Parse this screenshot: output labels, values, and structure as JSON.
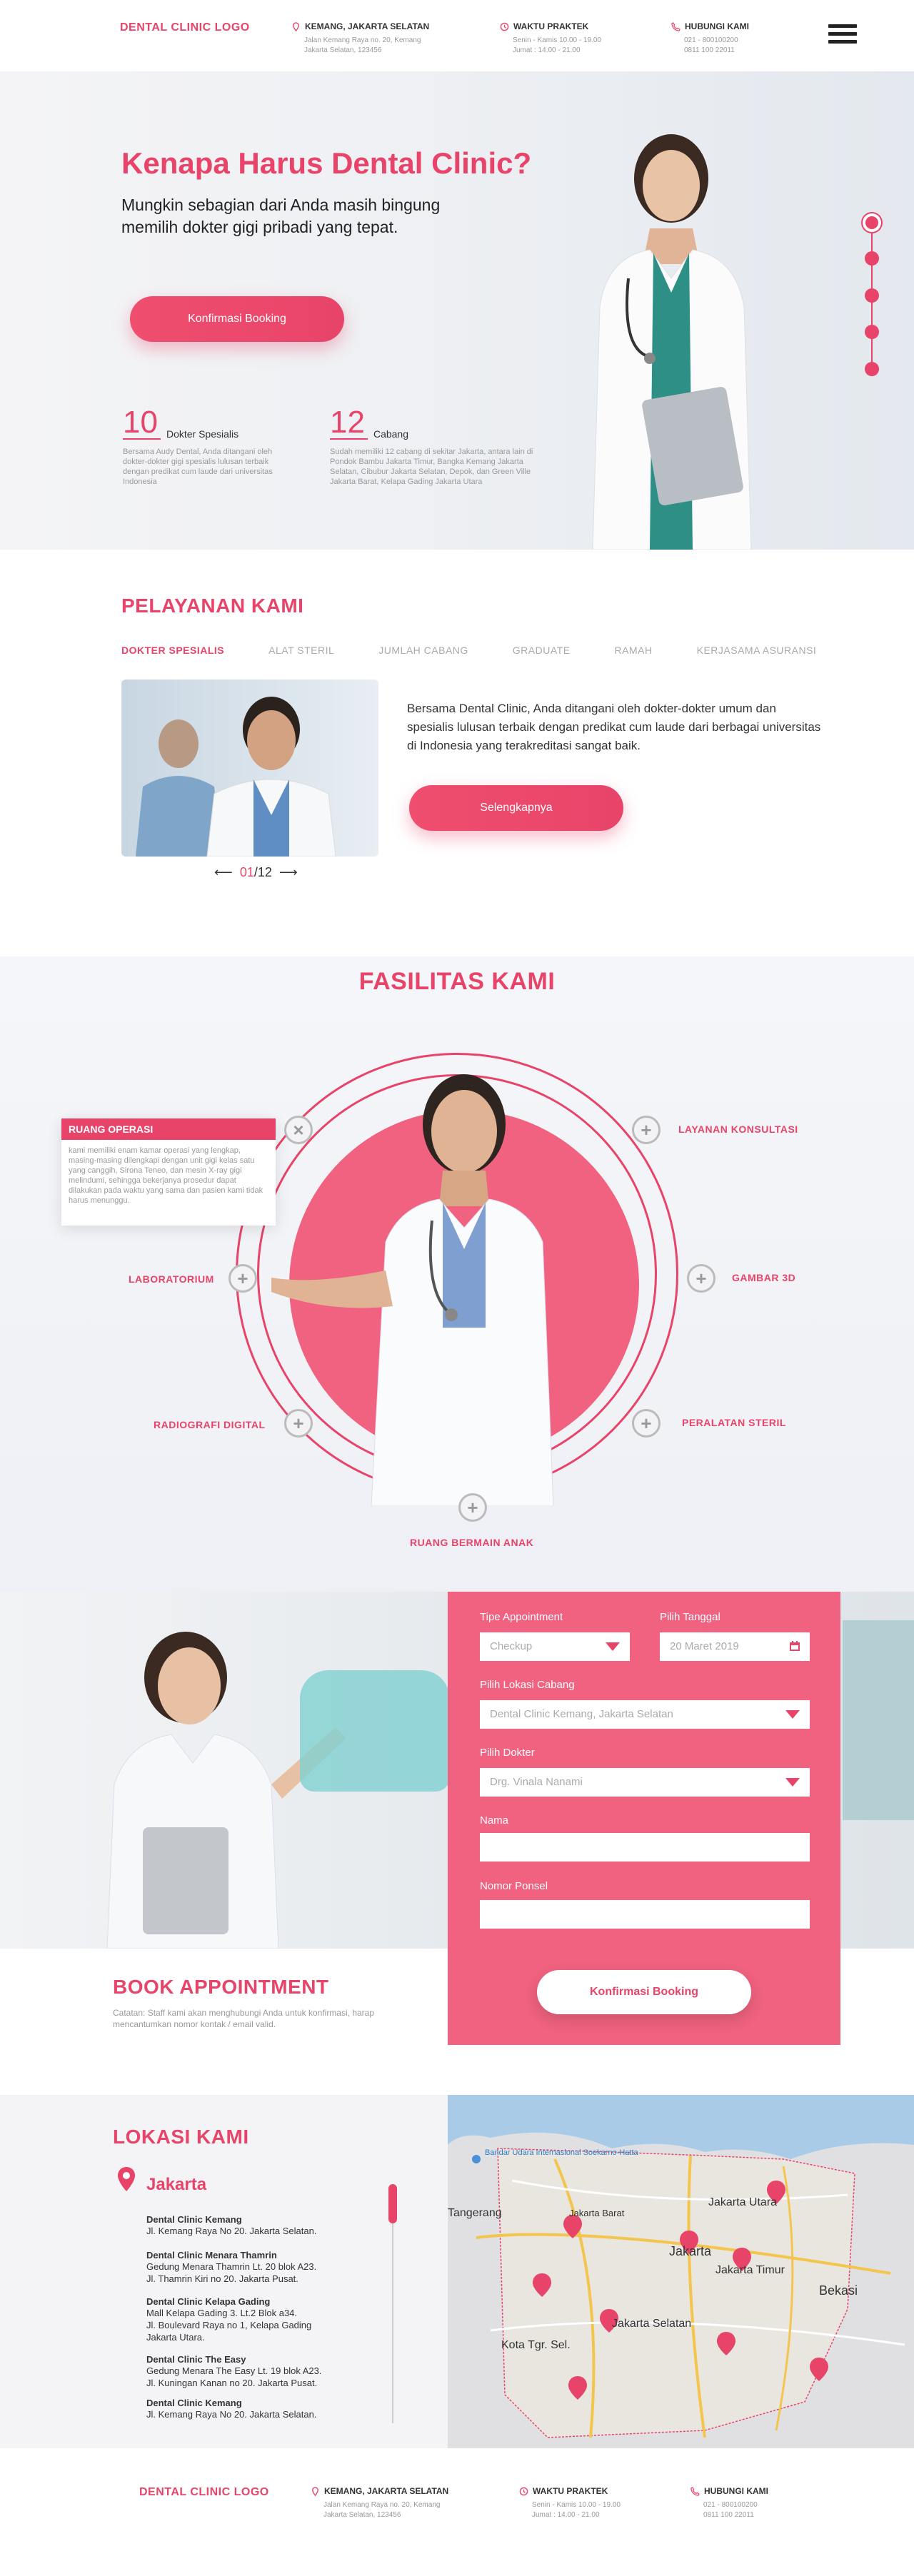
{
  "header": {
    "logo": "DENTAL CLINIC  LOGO",
    "location": {
      "title": "KEMANG, JAKARTA SELATAN",
      "line1": "Jalan Kemang Raya no. 20, Kemang",
      "line2": "Jakarta Selatan, 123456"
    },
    "hours": {
      "title": "WAKTU PRAKTEK",
      "line1": "Senin - Kamis 10.00 - 19.00",
      "line2": "Jumat : 14.00 - 21.00"
    },
    "contact": {
      "title": "HUBUNGI KAMI",
      "line1": "021 - 800100200",
      "line2": "0811 100 22011"
    }
  },
  "hero": {
    "title": "Kenapa Harus Dental Clinic?",
    "subtitle": "Mungkin sebagian dari Anda masih bingung memilih dokter gigi pribadi yang tepat.",
    "cta": "Konfirmasi Booking",
    "stats": [
      {
        "num": "10",
        "label": "Dokter Spesialis",
        "desc": "Bersama Audy Dental, Anda ditangani oleh dokter-dokter gigi spesialis lulusan terbaik dengan predikat cum laude dari universitas Indonesia"
      },
      {
        "num": "12",
        "label": "Cabang",
        "desc": "Sudah memiliki 12 cabang di sekitar Jakarta, antara lain di Pondok Bambu Jakarta Timur, Bangka Kemang Jakarta Selatan, Cibubur Jakarta Selatan, Depok, dan Green Ville Jakarta Barat, Kelapa Gading Jakarta Utara"
      }
    ]
  },
  "services": {
    "title": "PELAYANAN KAMI",
    "tabs": [
      "DOKTER SPESIALIS",
      "ALAT STERIL",
      "JUMLAH CABANG",
      "GRADUATE",
      "RAMAH",
      "KERJASAMA ASURANSI"
    ],
    "text": "Bersama Dental Clinic, Anda ditangani oleh dokter-dokter umum dan spesialis lulusan terbaik dengan predikat cum laude dari berbagai universitas di Indonesia yang terakreditasi sangat baik.",
    "button": "Selengkapnya",
    "pager_current": "01",
    "pager_total": "/12"
  },
  "facilities": {
    "title": "FASILITAS KAMI",
    "items": [
      "LAYANAN KONSULTASI",
      "GAMBAR 3D",
      "PERALATAN STERIL",
      "RUANG BERMAIN ANAK",
      "RADIOGRAFI DIGITAL",
      "LABORATORIUM"
    ],
    "popup_title": "RUANG OPERASI",
    "popup_text": "kami memiliki enam kamar operasi yang lengkap, masing-masing dilengkapi dengan unit gigi kelas satu yang canggih, Sirona Teneo, dan mesin X-ray gigi melindumi, sehingga bekerjanya prosedur dapat dilakukan pada waktu yang sama dan pasien kami tidak harus menunggu."
  },
  "booking": {
    "title": "BOOK APPOINTMENT",
    "note": "Catatan: Staff kami akan menghubungi Anda untuk konfirmasi, harap mencantumkan nomor kontak / email valid.",
    "labels": {
      "type": "Tipe Appointment",
      "date": "Pilih Tanggal",
      "branch": "Pilih Lokasi Cabang",
      "doctor": "Pilih Dokter",
      "name": "Nama",
      "phone": "Nomor Ponsel"
    },
    "values": {
      "type": "Checkup",
      "date": "20 Maret 2019",
      "branch": "Dental Clinic Kemang, Jakarta Selatan",
      "doctor": "Drg. Vinala Nanami"
    },
    "button": "Konfirmasi Booking"
  },
  "location": {
    "title": "LOKASI KAMI",
    "city": "Jakarta",
    "branches": [
      {
        "name": "Dental Clinic Kemang",
        "addr": [
          "Jl. Kemang Raya No 20. Jakarta Selatan."
        ]
      },
      {
        "name": "Dental Clinic Menara Thamrin",
        "addr": [
          "Gedung Menara Thamrin Lt. 20 blok A23.",
          "Jl. Thamrin Kiri no 20. Jakarta Pusat."
        ]
      },
      {
        "name": "Dental Clinic Kelapa Gading",
        "addr": [
          "Mall Kelapa Gading 3. Lt.2 Blok a34.",
          "Jl. Boulevard Raya no 1, Kelapa Gading",
          "Jakarta Utara."
        ]
      },
      {
        "name": "Dental Clinic The Easy",
        "addr": [
          "Gedung Menara The Easy Lt. 19 blok A23.",
          "Jl. Kuningan Kanan no 20. Jakarta Pusat."
        ]
      },
      {
        "name": "Dental Clinic Kemang",
        "addr": [
          "Jl. Kemang Raya No 20. Jakarta Selatan."
        ]
      }
    ],
    "map_labels": [
      "Bandar Udara Internasional Soekarno-Hatta",
      "Tangerang",
      "Jakarta Barat",
      "Jakarta Utara",
      "Jakarta",
      "Jakarta Timur",
      "Jakarta Selatan",
      "Kota Tgr. Sel.",
      "Bekasi"
    ]
  },
  "footer": {
    "logo": "DENTAL CLINIC  LOGO",
    "location": {
      "title": "KEMANG, JAKARTA SELATAN",
      "line1": "Jalan Kemang Raya no. 20, Kemang",
      "line2": "Jakarta Selatan, 123456"
    },
    "hours": {
      "title": "WAKTU PRAKTEK",
      "line1": "Senin - Kamis 10.00 - 19.00",
      "line2": "Jumat : 14.00 - 21.00"
    },
    "contact": {
      "title": "HUBUNGI KAMI",
      "line1": "021 - 800100200",
      "line2": "0811 100 22011"
    }
  },
  "colors": {
    "accent": "#e8446a",
    "form_bg": "#f0627f"
  }
}
